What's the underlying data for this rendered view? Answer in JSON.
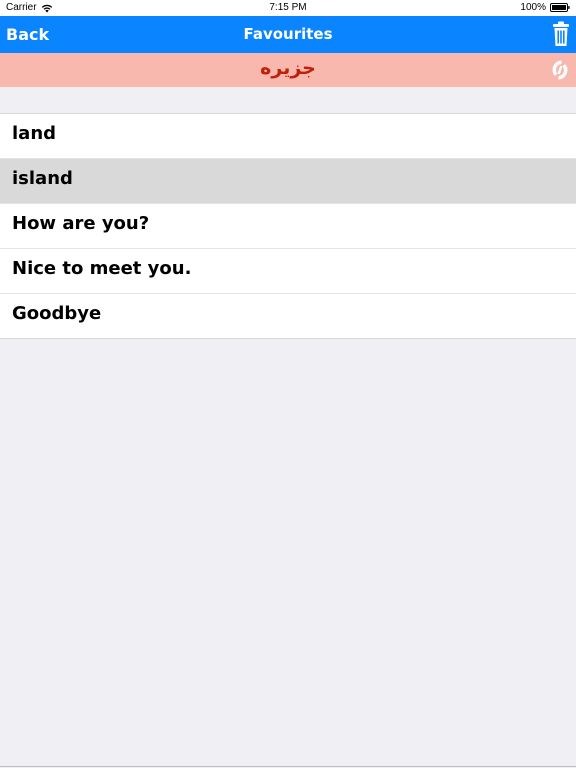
{
  "status_bar": {
    "carrier": "Carrier",
    "time": "7:15 PM",
    "battery": "100%",
    "icons": [
      "wifi-icon",
      "battery-icon"
    ]
  },
  "nav_bar": {
    "back_label": "Back",
    "title": "Favourites",
    "trash_icon": "trash-icon",
    "color": "#0a84ff"
  },
  "translation_bar": {
    "text": "جزيره",
    "share_icon": "share-icon",
    "background": "#f8b8ae",
    "text_color": "#c0200a"
  },
  "favourites": {
    "items": [
      {
        "label": "land",
        "selected": false
      },
      {
        "label": "island",
        "selected": true
      },
      {
        "label": "How are you?",
        "selected": false
      },
      {
        "label": "Nice to meet you.",
        "selected": false
      },
      {
        "label": "Goodbye",
        "selected": false
      }
    ]
  }
}
